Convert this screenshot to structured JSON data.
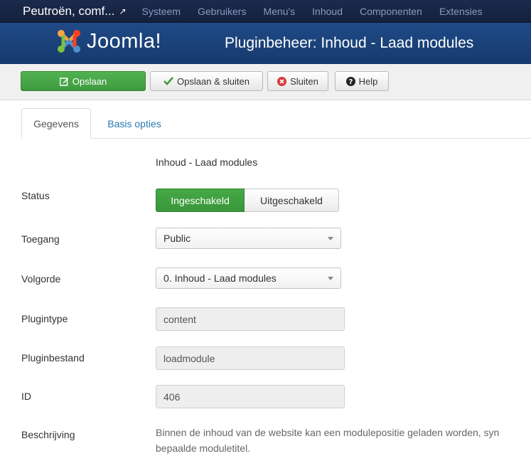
{
  "topnav": {
    "site_name": "Peutroën, comf...",
    "items": [
      "Systeem",
      "Gebruikers",
      "Menu's",
      "Inhoud",
      "Componenten",
      "Extensies"
    ]
  },
  "header": {
    "logo_text": "Joomla!",
    "title": "Pluginbeheer: Inhoud - Laad modules"
  },
  "toolbar": {
    "save_label": "Opslaan",
    "save_close_label": "Opslaan & sluiten",
    "close_label": "Sluiten",
    "help_label": "Help"
  },
  "tabs": [
    {
      "label": "Gegevens",
      "active": true
    },
    {
      "label": "Basis opties",
      "active": false
    }
  ],
  "form": {
    "plugin_name": "Inhoud - Laad modules",
    "status": {
      "label": "Status",
      "on": "Ingeschakeld",
      "off": "Uitgeschakeld",
      "selected": "Ingeschakeld"
    },
    "access": {
      "label": "Toegang",
      "value": "Public"
    },
    "ordering": {
      "label": "Volgorde",
      "value": "0. Inhoud - Laad modules"
    },
    "plugintype": {
      "label": "Plugintype",
      "value": "content"
    },
    "pluginfile": {
      "label": "Pluginbestand",
      "value": "loadmodule"
    },
    "id": {
      "label": "ID",
      "value": "406"
    },
    "description": {
      "label": "Beschrijving",
      "line1": "Binnen de inhoud van de website kan een modulepositie geladen worden, syn",
      "line2": "bepaalde moduletitel."
    }
  },
  "colors": {
    "accent_green": "#46a546",
    "header_blue": "#1f4a86",
    "nav_dark": "#1b2b4d",
    "link_blue": "#2a7ab0"
  }
}
